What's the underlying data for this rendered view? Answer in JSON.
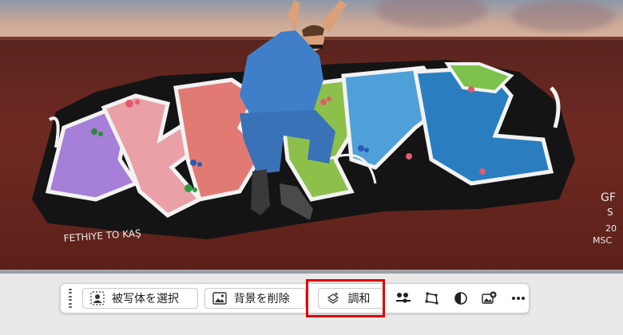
{
  "canvas": {
    "description_alt": "photo",
    "graffiti_text_left": "FETHIYE TO KAŞ",
    "graffiti_text_right_1": "GF",
    "graffiti_text_right_2": "S",
    "graffiti_text_right_3": "20",
    "graffiti_text_right_4": "MSC"
  },
  "toolbar": {
    "select_subject_label": "被写体を選択",
    "remove_background_label": "背景を削除",
    "harmonize_label": "調和"
  },
  "icons": {
    "grip": "drag-handle-icon",
    "select_subject": "person-select-icon",
    "remove_background": "image-remove-icon",
    "harmonize": "harmonize-sparkle-icon",
    "adjust": "adjust-sliders-icon",
    "transform": "transform-shape-icon",
    "mask": "contrast-mask-icon",
    "add_layer": "add-image-layer-icon",
    "more": "more-icon"
  },
  "colors": {
    "highlight": "#e00000",
    "wall": "#6e2a22"
  }
}
